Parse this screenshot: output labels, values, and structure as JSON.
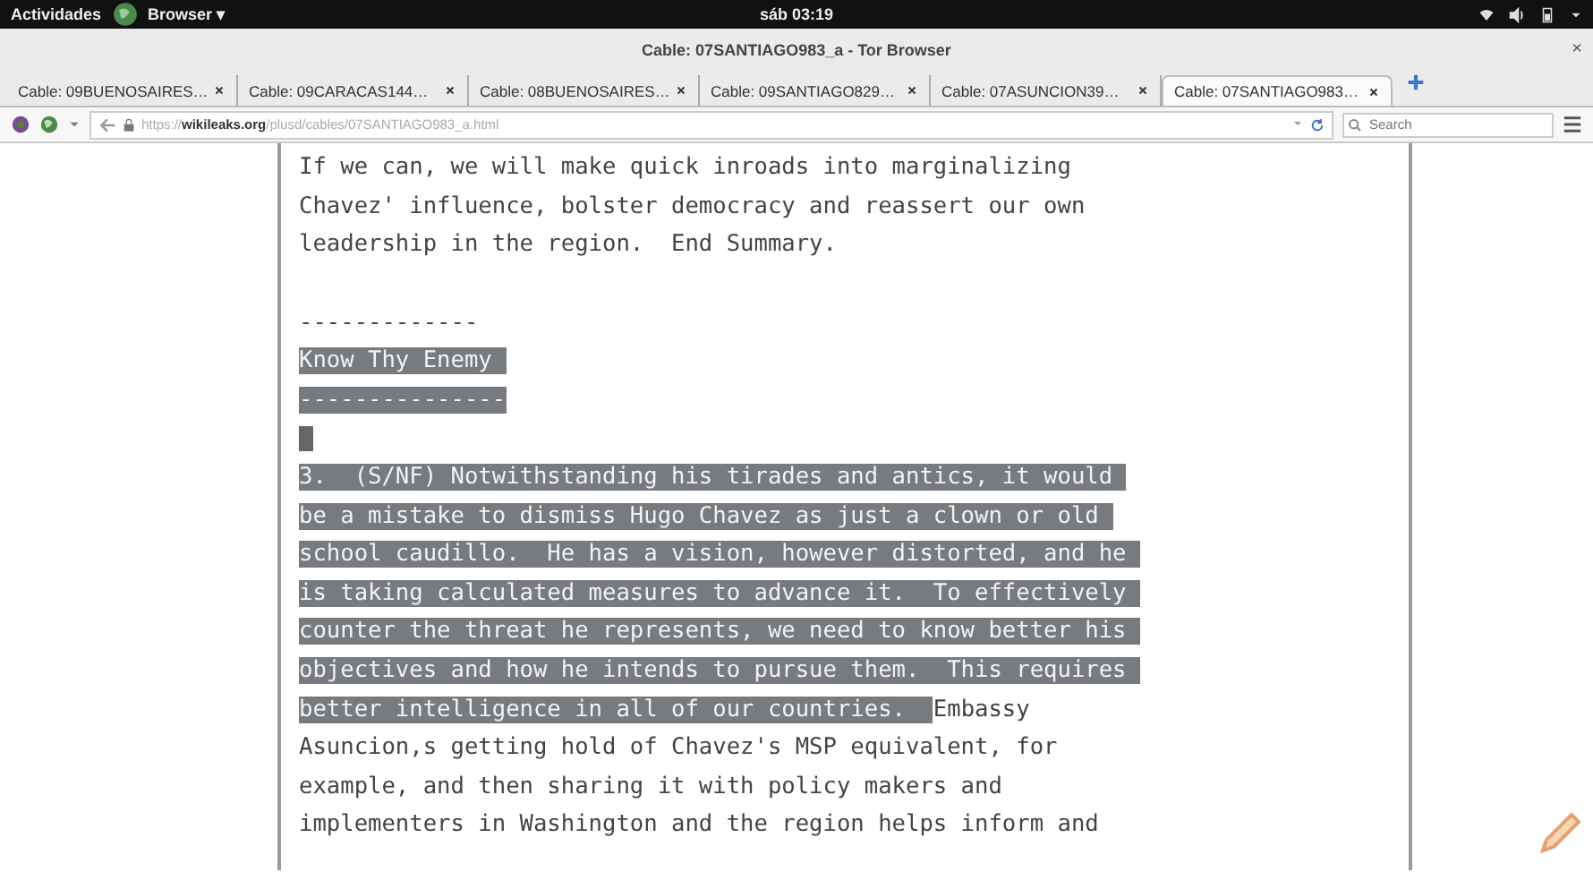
{
  "top_bar": {
    "activities": "Actividades",
    "app_menu": "Browser ▾",
    "clock": "sáb 03:19"
  },
  "window": {
    "title": "Cable: 07SANTIAGO983_a - Tor Browser",
    "close": "×"
  },
  "tabs": [
    {
      "label": "Cable: 09BUENOSAIRES…",
      "selected": false
    },
    {
      "label": "Cable: 09CARACAS144…",
      "selected": false
    },
    {
      "label": "Cable: 08BUENOSAIRES…",
      "selected": false
    },
    {
      "label": "Cable: 09SANTIAGO829…",
      "selected": false
    },
    {
      "label": "Cable: 07ASUNCION39…",
      "selected": false
    },
    {
      "label": "Cable: 07SANTIAGO983…",
      "selected": true
    }
  ],
  "nav_bar": {
    "url": {
      "scheme": "https://",
      "host": "wikileaks.org",
      "path": "/plusd/cables/07SANTIAGO983_a.html"
    },
    "search": {
      "placeholder": "Search"
    }
  },
  "document": {
    "lines": [
      {
        "kind": "text",
        "segments": [
          {
            "text": "If we can, we will make quick inroads into marginalizing",
            "selected": false
          }
        ]
      },
      {
        "kind": "text",
        "segments": [
          {
            "text": "Chavez' influence, bolster democracy and reassert our own",
            "selected": false
          }
        ]
      },
      {
        "kind": "text",
        "segments": [
          {
            "text": "leadership in the region.  End Summary.",
            "selected": false
          }
        ]
      },
      {
        "kind": "blank",
        "selected": false
      },
      {
        "kind": "text",
        "segments": [
          {
            "text": "-------------",
            "selected": false
          }
        ]
      },
      {
        "kind": "text",
        "segments": [
          {
            "text": "Know Thy Enemy ",
            "selected": true
          }
        ]
      },
      {
        "kind": "text",
        "segments": [
          {
            "text": "---------------",
            "selected": true
          }
        ]
      },
      {
        "kind": "blank",
        "selected": true
      },
      {
        "kind": "text",
        "segments": [
          {
            "text": "3.  (S/NF) Notwithstanding his tirades and antics, it would ",
            "selected": true
          }
        ]
      },
      {
        "kind": "text",
        "segments": [
          {
            "text": "be a mistake to dismiss Hugo Chavez as just a clown or old ",
            "selected": true
          }
        ]
      },
      {
        "kind": "text",
        "segments": [
          {
            "text": "school caudillo.  He has a vision, however distorted, and he ",
            "selected": true
          }
        ]
      },
      {
        "kind": "text",
        "segments": [
          {
            "text": "is taking calculated measures to advance it.  To effectively ",
            "selected": true
          }
        ]
      },
      {
        "kind": "text",
        "segments": [
          {
            "text": "counter the threat he represents, we need to know better his ",
            "selected": true
          }
        ]
      },
      {
        "kind": "text",
        "segments": [
          {
            "text": "objectives and how he intends to pursue them.  This requires ",
            "selected": true
          }
        ]
      },
      {
        "kind": "text",
        "segments": [
          {
            "text": "better intelligence in all of our countries.  ",
            "selected": true
          },
          {
            "text": "Embassy",
            "selected": false
          }
        ]
      },
      {
        "kind": "text",
        "segments": [
          {
            "text": "Asuncion,s getting hold of Chavez's MSP equivalent, for",
            "selected": false
          }
        ]
      },
      {
        "kind": "text",
        "segments": [
          {
            "text": "example, and then sharing it with policy makers and",
            "selected": false
          }
        ]
      },
      {
        "kind": "text",
        "segments": [
          {
            "text": "implementers in Washington and the region helps inform and",
            "selected": false
          }
        ]
      }
    ]
  }
}
